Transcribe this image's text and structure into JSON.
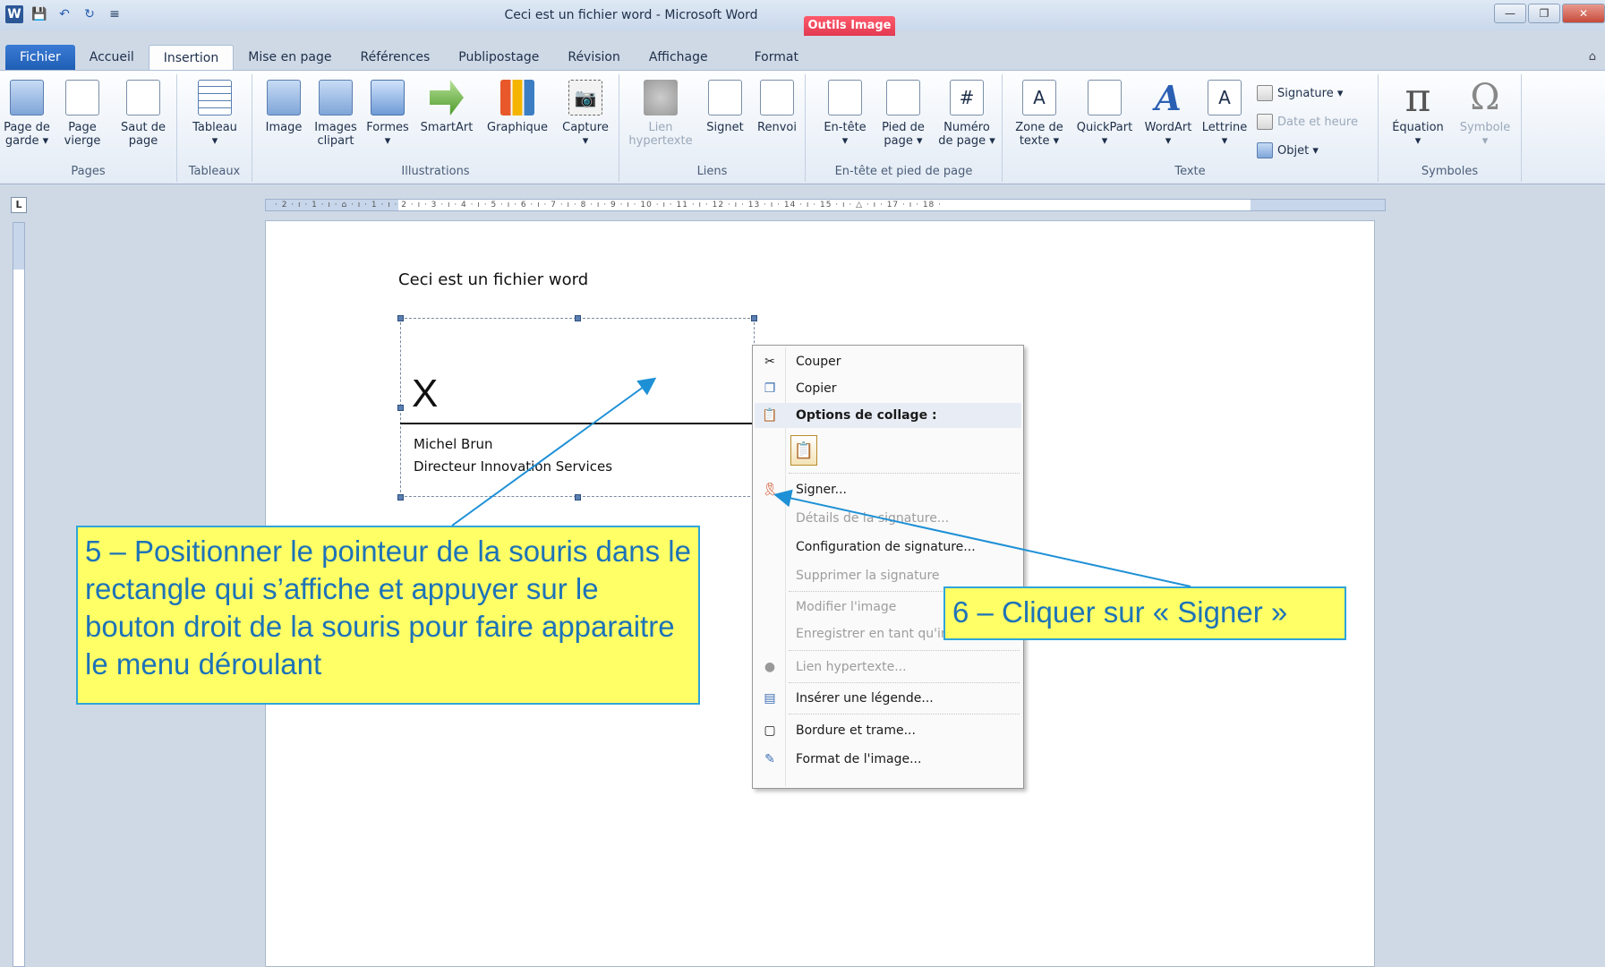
{
  "titlebar": {
    "title": "Ceci est un fichier word - Microsoft Word",
    "contextual_tab": "Outils Image",
    "qat": [
      "W",
      "💾",
      "↶",
      "↻",
      "≡"
    ]
  },
  "tabs": {
    "file": "Fichier",
    "items": [
      "Accueil",
      "Insertion",
      "Mise en page",
      "Références",
      "Publipostage",
      "Révision",
      "Affichage",
      "Format"
    ],
    "active": "Insertion"
  },
  "ribbon": {
    "pages": {
      "label": "Pages",
      "cover": "Page de\ngarde ▾",
      "blank": "Page\nvierge",
      "break": "Saut de\npage"
    },
    "tables": {
      "label": "Tableaux",
      "table": "Tableau\n▾"
    },
    "illustrations": {
      "label": "Illustrations",
      "image": "Image",
      "clipart": "Images\nclipart",
      "shapes": "Formes\n▾",
      "smartart": "SmartArt",
      "chart": "Graphique",
      "capture": "Capture\n▾"
    },
    "links": {
      "label": "Liens",
      "hyperlink": "Lien\nhypertexte",
      "bookmark": "Signet",
      "crossref": "Renvoi"
    },
    "header_footer": {
      "label": "En-tête et pied de page",
      "header": "En-tête\n▾",
      "footer": "Pied de\npage ▾",
      "pagenum": "Numéro\nde page ▾"
    },
    "text": {
      "label": "Texte",
      "textbox": "Zone de\ntexte ▾",
      "quickpart": "QuickPart\n▾",
      "wordart": "WordArt\n▾",
      "dropcap": "Lettrine\n▾",
      "signature": "Signature ▾",
      "datetime": "Date et heure",
      "object": "Objet ▾"
    },
    "symbols": {
      "label": "Symboles",
      "equation": "Équation\n▾",
      "symbol": "Symbole\n▾"
    }
  },
  "ruler": {
    "corner": "L",
    "ticks": "· 2 · ı · 1 · ı · ⌂ · ı · 1 · ı · 2 · ı · 3 · ı · 4 · ı · 5 · ı · 6 · ı · 7 · ı · 8 · ı · 9 · ı · 10 · ı · 11 · ı · 12 · ı · 13 · ı · 14 · ı · 15 · ı · △ · ı · 17 · ı · 18 ·"
  },
  "document": {
    "text": "Ceci est un fichier word",
    "signature": {
      "x": "X",
      "name": "Michel Brun",
      "title": "Directeur Innovation Services"
    }
  },
  "context_menu": {
    "items": [
      {
        "label": "Couper",
        "icon": "scissors-icon"
      },
      {
        "label": "Copier",
        "icon": "copy-icon"
      },
      {
        "label": "Options de collage :",
        "icon": "paste-options-icon"
      },
      {
        "label": "Signer...",
        "icon": "sign-ribbon-icon"
      },
      {
        "label": "Détails de la signature...",
        "icon": ""
      },
      {
        "label": "Configuration de signature...",
        "icon": ""
      },
      {
        "label": "Supprimer la signature",
        "icon": ""
      },
      {
        "label": "Modifier l'image",
        "icon": ""
      },
      {
        "label": "Enregistrer en tant qu'image...",
        "icon": ""
      },
      {
        "label": "Lien hypertexte...",
        "icon": "hyperlink-icon"
      },
      {
        "label": "Insérer une légende...",
        "icon": "caption-icon"
      },
      {
        "label": "Bordure et trame...",
        "icon": "border-icon"
      },
      {
        "label": "Format de l'image...",
        "icon": "format-image-icon"
      }
    ]
  },
  "callouts": {
    "step5": "5 – Positionner le pointeur de la souris dans le rectangle qui s’affiche et appuyer sur le bouton droit de la souris pour faire apparaitre le menu déroulant",
    "step6": "6 – Cliquer sur « Signer »"
  },
  "colors": {
    "callout_bg": "#ffff66",
    "callout_border": "#2fa4d9",
    "callout_text": "#1e73b8",
    "tools_tab": "#e23a52"
  }
}
